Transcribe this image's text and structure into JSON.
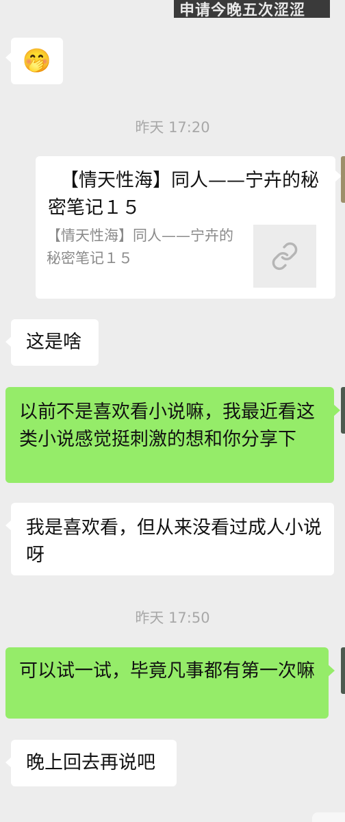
{
  "banner": {
    "text": "申请今晚五次涩涩"
  },
  "timestamps": [
    "昨天 17:20",
    "昨天 17:50"
  ],
  "messages": [
    {
      "side": "left",
      "emoji": "🤭"
    },
    {
      "side": "right",
      "type": "link",
      "title": "【情天性海】同人——宁卉的秘密笔记１５",
      "description": "【情天性海】同人——宁卉的秘密笔记１５",
      "thumb_icon": "link-icon"
    },
    {
      "side": "left",
      "text": "这是啥"
    },
    {
      "side": "right",
      "text": "以前不是喜欢看小说嘛，我最近看这类小说感觉挺刺激的想和你分享下"
    },
    {
      "side": "left",
      "text": "我是喜欢看，但从来没看过成人小说呀"
    },
    {
      "side": "right",
      "text": "可以试一试，毕竟凡事都有第一次嘛"
    },
    {
      "side": "left",
      "text": "晚上回去再说吧"
    }
  ],
  "colors": {
    "background": "#ededed",
    "sent_bubble": "#95ec69",
    "received_bubble": "#ffffff",
    "timestamp": "#a8a8a8"
  }
}
